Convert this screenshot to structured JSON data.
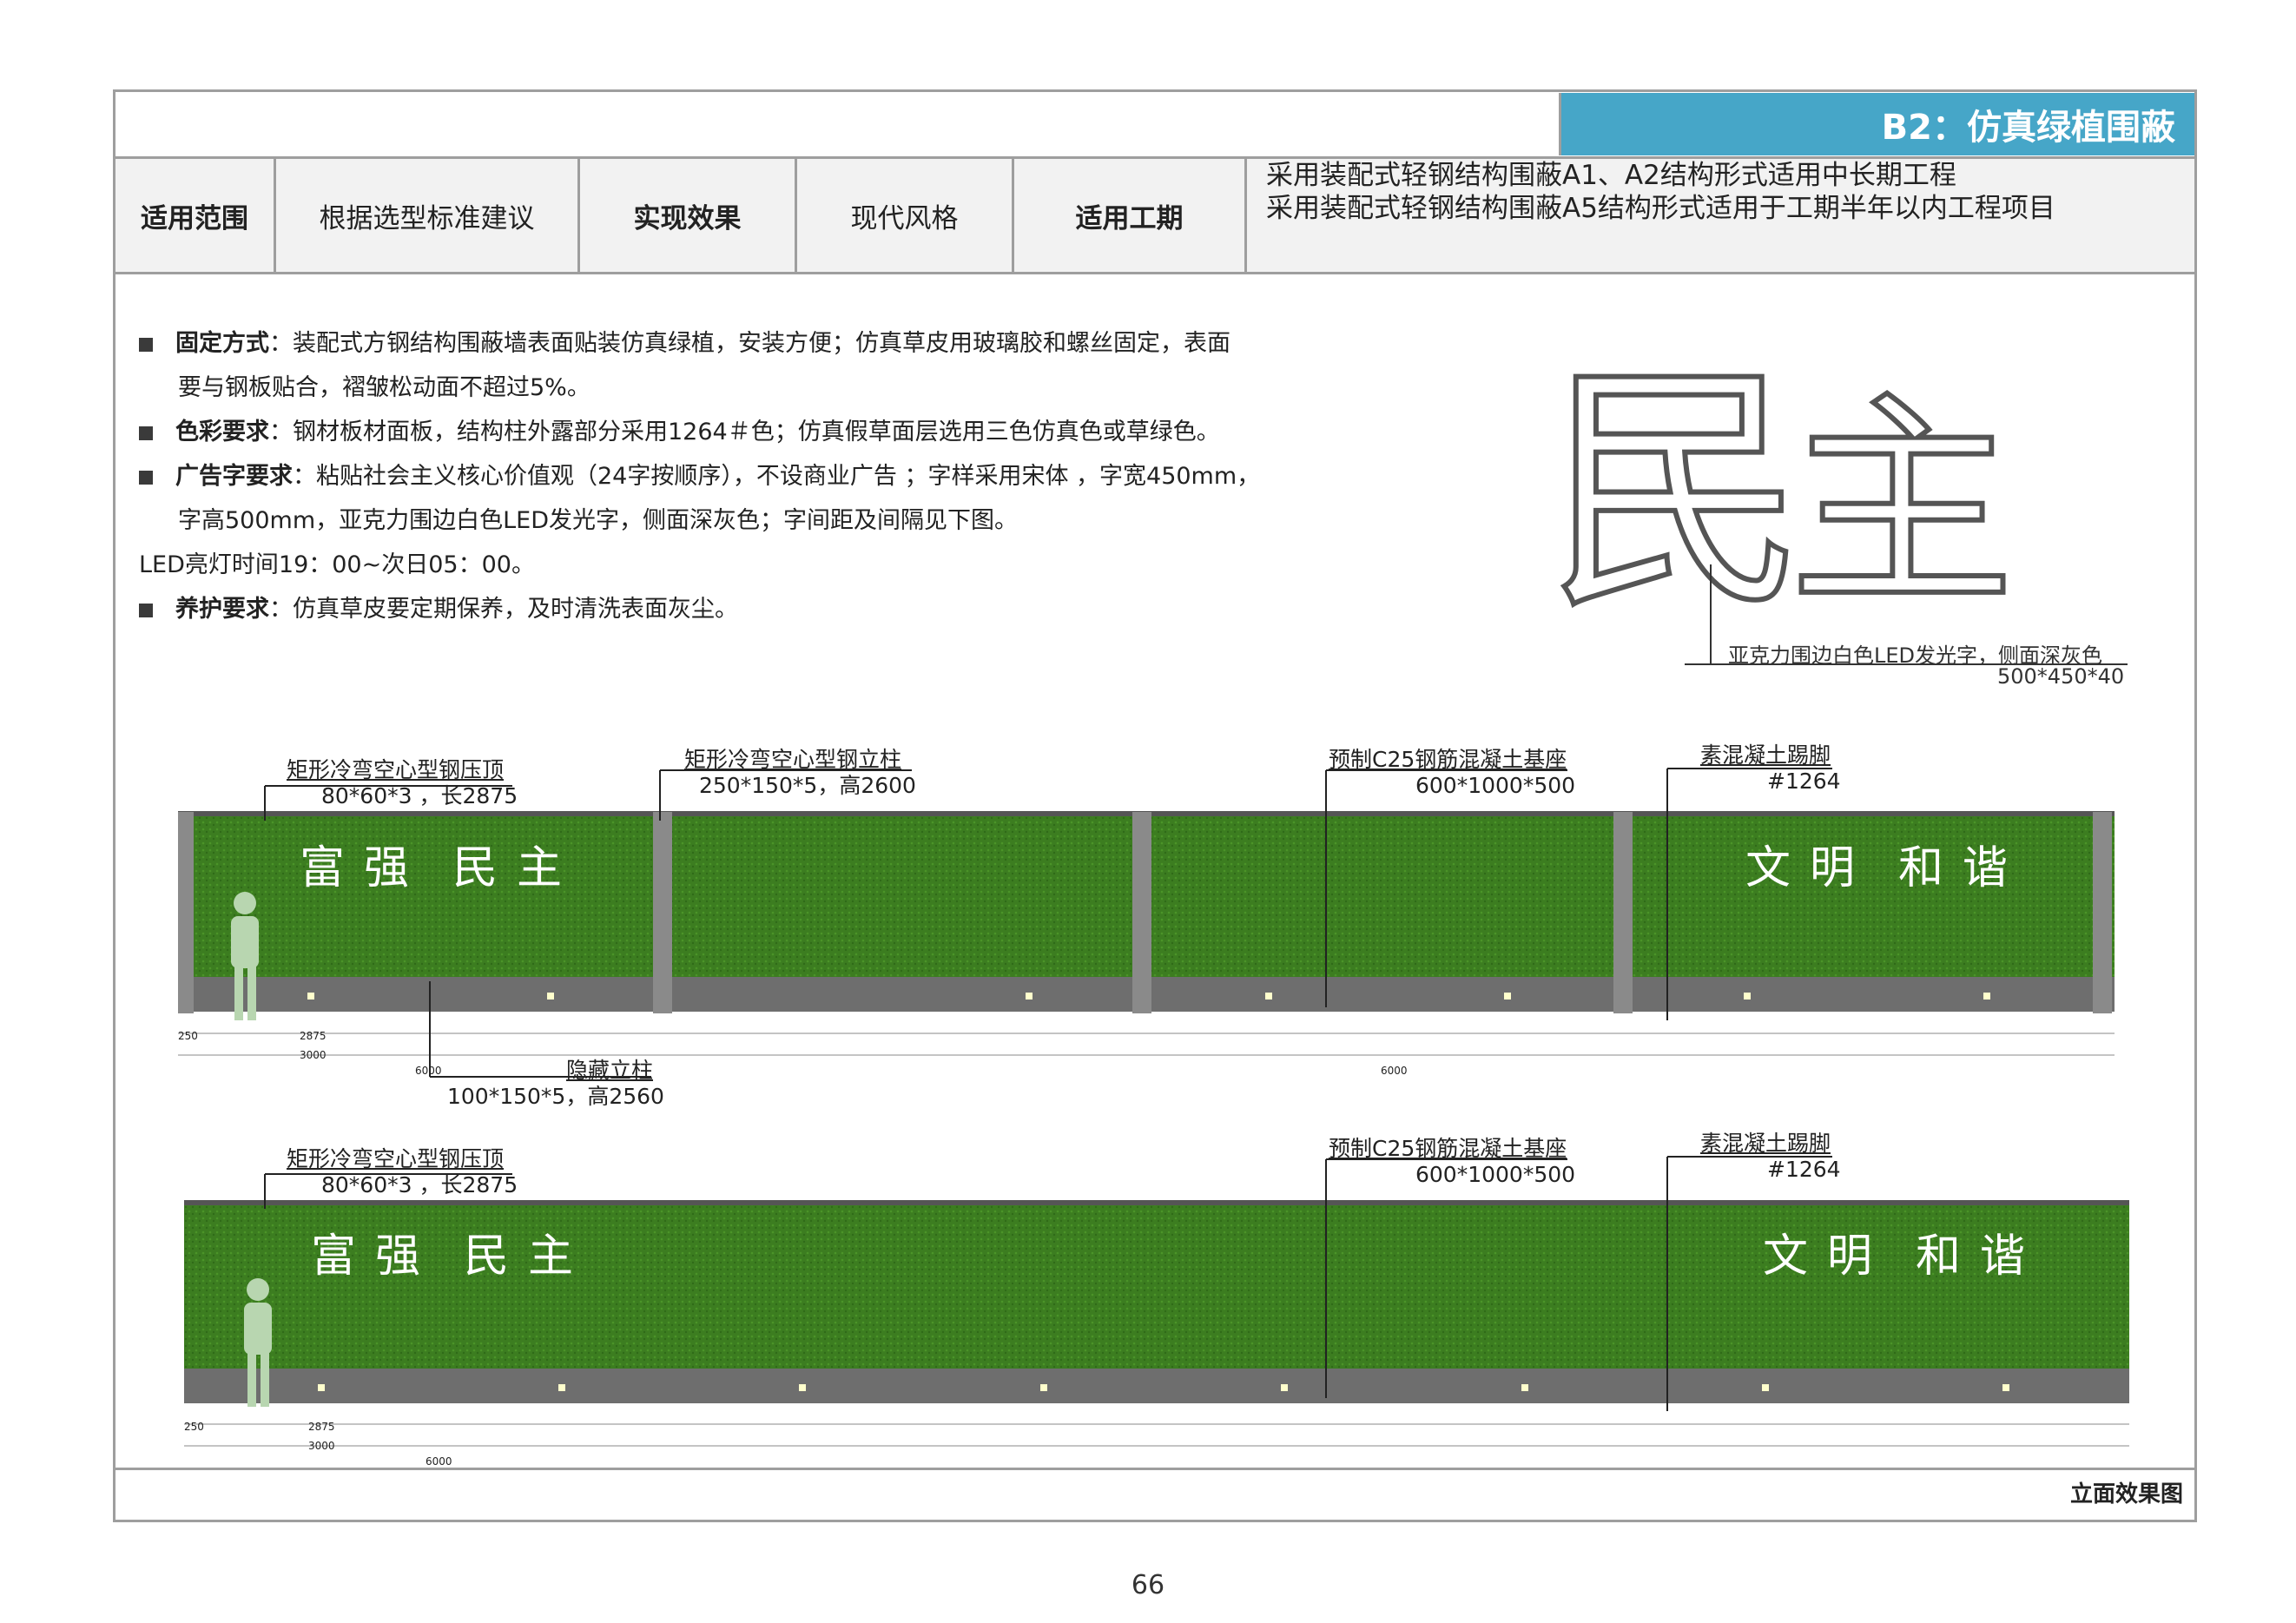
{
  "title": "B2：仿真绿植围蔽",
  "header": {
    "scope_label": "适用范围",
    "scope_value": "根据选型标准建议",
    "effect_label": "实现效果",
    "effect_value": "现代风格",
    "period_label": "适用工期",
    "period_line1": "采用装配式轻钢结构围蔽A1、A2结构形式适用中长期工程",
    "period_line2": "采用装配式轻钢结构围蔽A5结构形式适用于工期半年以内工程项目"
  },
  "requirements": {
    "fix_label": "固定方式",
    "fix_text1": "：装配式方钢结构围蔽墙表面贴装仿真绿植，安装方便；仿真草皮用玻璃胶和螺丝固定，表面",
    "fix_text2": "要与钢板贴合，褶皱松动面不超过5%。",
    "color_label": "色彩要求",
    "color_text": "：钢材板材面板，结构柱外露部分采用1264＃色；仿真假草面层选用三色仿真色或草绿色。",
    "ad_label": "广告字要求",
    "ad_text1": "：粘贴社会主义核心价值观（24字按顺序），不设商业广告 ；字样采用宋体 ，字宽450mm，",
    "ad_text2": "字高500mm，亚克力围边白色LED发光字，侧面深灰色；字间距及间隔见下图。",
    "led_text": "LED亮灯时间19：00~次日05：00。",
    "care_label": "养护要求",
    "care_text": "：仿真草皮要定期保养，及时清洗表面灰尘。"
  },
  "illustration": {
    "chars": "民主",
    "note_line1": "亚克力围边白色LED发光字，侧面深灰色",
    "note_line2": "500*450*40"
  },
  "elevation1": {
    "top_cap_label": "矩形冷弯空心型钢压顶",
    "top_cap_spec": "80*60*3 ，长2875",
    "column_label": "矩形冷弯空心型钢立柱",
    "column_spec": "250*150*5，高2600",
    "base_label": "预制C25钢筋混凝土基座",
    "base_spec": "600*1000*500",
    "kick_label": "素混凝土踢脚",
    "kick_spec": "#1264",
    "hidden_label": "隐藏立柱",
    "hidden_spec": "100*150*5，高2560",
    "words_left": [
      "富",
      "强",
      "民",
      "主"
    ],
    "words_right": [
      "文",
      "明",
      "和",
      "谐"
    ]
  },
  "elevation2": {
    "top_cap_label": "矩形冷弯空心型钢压顶",
    "top_cap_spec": "80*60*3 ，长2875",
    "base_label": "预制C25钢筋混凝土基座",
    "base_spec": "600*1000*500",
    "kick_label": "素混凝土踢脚",
    "kick_spec": "#1264",
    "words_left": [
      "富",
      "强",
      "民",
      "主"
    ],
    "words_right": [
      "文",
      "明",
      "和",
      "谐"
    ]
  },
  "dims": {
    "d250": "250",
    "d2875": "2875",
    "d3000": "3000",
    "d6000": "6000",
    "d450": "450",
    "d500": "500"
  },
  "caption": "立面效果图",
  "page_number": "66",
  "colors": {
    "title_bg": "#46a6c8",
    "grass": "#3a7a1e",
    "base": "#6e6e6e",
    "column": "#8a8a8a"
  }
}
